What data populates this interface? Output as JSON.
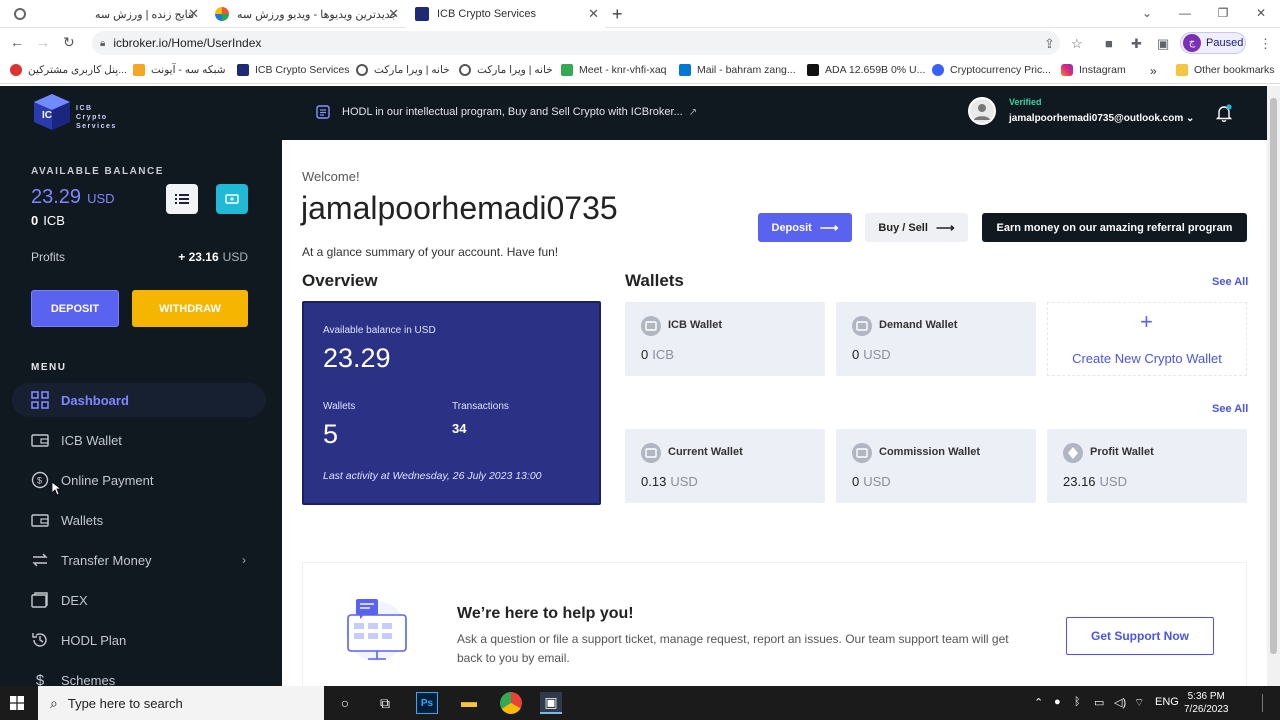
{
  "browser": {
    "tabs": [
      {
        "label": "نتایج زنده | ورزش سه"
      },
      {
        "label": "جدیدترین ویدیوها - ویدیو ورزش سه"
      },
      {
        "label": "ICB Crypto Services"
      }
    ],
    "new_tab": "+",
    "url": "icbroker.io/Home/UserIndex",
    "profile_status": "Paused",
    "profile_initial": "ج",
    "bookmarks": [
      {
        "label": "پنل کاربری مشترکین...",
        "color": "#d33"
      },
      {
        "label": "شبکه سه - آیونت",
        "color": "#f5a623"
      },
      {
        "label": "ICB Crypto Services",
        "color": "#1e2a78"
      },
      {
        "label": "خانه | ویرا مارکت",
        "color": "#555"
      },
      {
        "label": "خانه | ویرا مارکت",
        "color": "#555"
      },
      {
        "label": "Meet - knr-vhfi-xaq",
        "color": "#34a853"
      },
      {
        "label": "Mail - bahram zang...",
        "color": "#0078d4"
      },
      {
        "label": "ADA 12.659B 0% U...",
        "color": "#111"
      },
      {
        "label": "Cryptocurrency Pric...",
        "color": "#3861fb"
      },
      {
        "label": "Instagram",
        "color": "#d6249f"
      },
      {
        "label": "Other bookmarks",
        "color": "#f5c542"
      }
    ],
    "more_bookmarks": "»"
  },
  "sidebar": {
    "available_balance_label": "AVAILABLE BALANCE",
    "balance_usd": "23.29",
    "balance_usd_unit": "USD",
    "balance_icb": "0",
    "balance_icb_unit": "ICB",
    "profits_label": "Profits",
    "profits_value": "+ 23.16",
    "profits_unit": "USD",
    "deposit_label": "DEPOSIT",
    "withdraw_label": "WITHDRAW",
    "menu_heading": "MENU",
    "menu": [
      {
        "label": "Dashboard"
      },
      {
        "label": "ICB Wallet"
      },
      {
        "label": "Online Payment"
      },
      {
        "label": "Wallets"
      },
      {
        "label": "Transfer Money"
      },
      {
        "label": "DEX"
      },
      {
        "label": "HODL Plan"
      },
      {
        "label": "Schemes"
      }
    ]
  },
  "header": {
    "notice": "HODL in our intellectual program, Buy and Sell Crypto with ICBroker...",
    "verified": "Verified",
    "email": "jamalpoorhemadi0735@outlook.com"
  },
  "main": {
    "welcome": "Welcome!",
    "username": "jamalpoorhemadi0735",
    "glance": "At a glance summary of your account. Have fun!",
    "deposit_btn": "Deposit",
    "buy_sell_btn": "Buy / Sell",
    "referral_btn": "Earn money on our amazing referral program",
    "overview_title": "Overview",
    "overview": {
      "balance_label": "Available balance in USD",
      "balance_value": "23.29",
      "wallets_label": "Wallets",
      "wallets_value": "5",
      "transactions_label": "Transactions",
      "transactions_value": "34",
      "last_activity": "Last activity at Wednesday, 26 July 2023 13:00"
    },
    "wallets_title": "Wallets",
    "see_all": "See All",
    "wallets_row1": [
      {
        "name": "ICB Wallet",
        "value": "0",
        "unit": "ICB"
      },
      {
        "name": "Demand Wallet",
        "value": "0",
        "unit": "USD"
      }
    ],
    "create_wallet": "Create New Crypto Wallet",
    "create_plus": "+",
    "wallets_row2": [
      {
        "name": "Current Wallet",
        "value": "0.13",
        "unit": "USD"
      },
      {
        "name": "Commission Wallet",
        "value": "0",
        "unit": "USD"
      },
      {
        "name": "Profit Wallet",
        "value": "23.16",
        "unit": "USD"
      }
    ],
    "support": {
      "title": "We’re here to help you!",
      "description": "Ask a question or file a support ticket, manage request, report an issues. Our team support team will get back to you by email.",
      "button": "Get Support Now"
    }
  },
  "taskbar": {
    "search_placeholder": "Type here to search",
    "language": "ENG",
    "time": "5:36 PM",
    "date": "7/26/2023"
  },
  "colors": {
    "sidebar_bg": "#101820",
    "accent": "#5a62f0",
    "withdraw": "#f6b500",
    "overview_card": "#2b3286"
  }
}
